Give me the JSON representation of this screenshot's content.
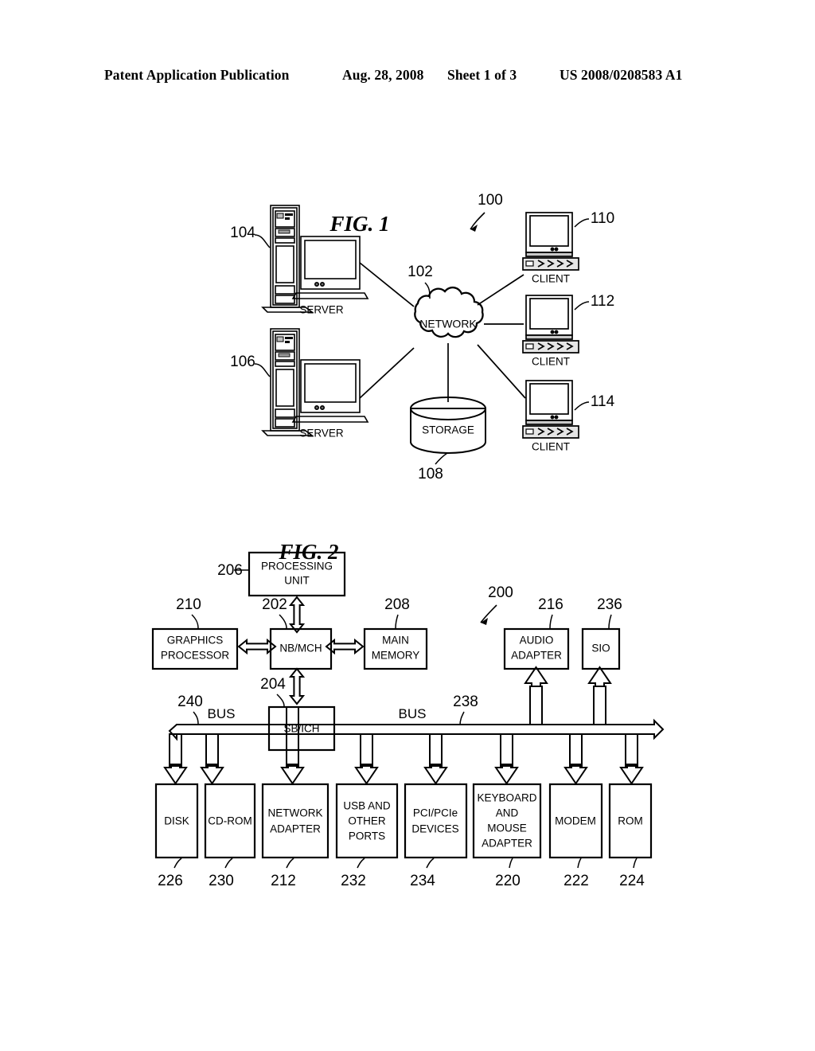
{
  "header": {
    "publication": "Patent Application Publication",
    "date": "Aug. 28, 2008",
    "sheet": "Sheet 1 of 3",
    "patent_number": "US 2008/0208583 A1"
  },
  "figure1": {
    "title": "FIG. 1",
    "system_ref": "100",
    "nodes": {
      "server_top": {
        "label": "SERVER",
        "ref": "104"
      },
      "server_bottom": {
        "label": "SERVER",
        "ref": "106"
      },
      "network": {
        "label": "NETWORK",
        "ref": "102"
      },
      "storage": {
        "label": "STORAGE",
        "ref": "108"
      },
      "client_top": {
        "label": "CLIENT",
        "ref": "110"
      },
      "client_mid": {
        "label": "CLIENT",
        "ref": "112"
      },
      "client_bottom": {
        "label": "CLIENT",
        "ref": "114"
      }
    }
  },
  "figure2": {
    "title": "FIG. 2",
    "system_ref": "200",
    "blocks": {
      "processing_unit": {
        "label_line1": "PROCESSING",
        "label_line2": "UNIT",
        "ref": "206"
      },
      "nbmch": {
        "label": "NB/MCH",
        "ref": "202"
      },
      "graphics_processor": {
        "label_line1": "GRAPHICS",
        "label_line2": "PROCESSOR",
        "ref": "210"
      },
      "main_memory": {
        "label_line1": "MAIN",
        "label_line2": "MEMORY",
        "ref": "208"
      },
      "audio_adapter": {
        "label_line1": "AUDIO",
        "label_line2": "ADAPTER",
        "ref": "216"
      },
      "sio": {
        "label": "SIO",
        "ref": "236"
      },
      "sbich": {
        "label": "SB/ICH",
        "ref": "204"
      },
      "disk": {
        "label": "DISK",
        "ref": "226"
      },
      "cdrom": {
        "label": "CD-ROM",
        "ref": "230"
      },
      "network_adapter": {
        "label_line1": "NETWORK",
        "label_line2": "ADAPTER",
        "ref": "212"
      },
      "usb_ports": {
        "label_line1": "USB AND",
        "label_line2": "OTHER",
        "label_line3": "PORTS",
        "ref": "232"
      },
      "pci_devices": {
        "label_line1": "PCI/PCIe",
        "label_line2": "DEVICES",
        "ref": "234"
      },
      "keyboard_mouse": {
        "label_line1": "KEYBOARD",
        "label_line2": "AND",
        "label_line3": "MOUSE",
        "label_line4": "ADAPTER",
        "ref": "220"
      },
      "modem": {
        "label": "MODEM",
        "ref": "222"
      },
      "rom": {
        "label": "ROM",
        "ref": "224"
      }
    },
    "bus_left": {
      "label": "BUS",
      "ref": "240"
    },
    "bus_right": {
      "label": "BUS",
      "ref": "238"
    }
  }
}
